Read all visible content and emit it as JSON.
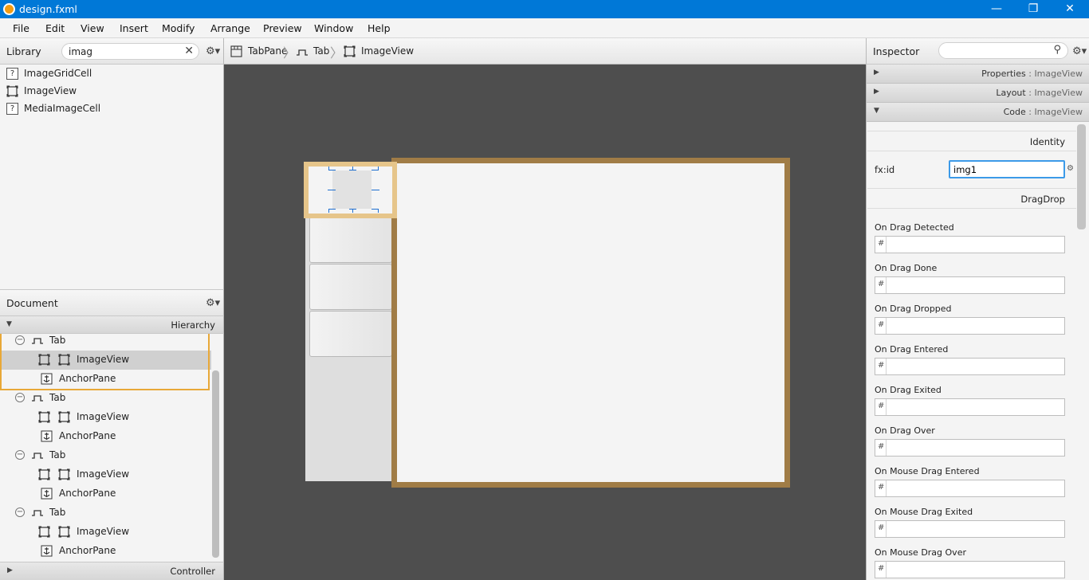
{
  "window": {
    "title": "design.fxml",
    "minimize_glyph": "—",
    "maximize_glyph": "❐",
    "close_glyph": "✕"
  },
  "menu": [
    "File",
    "Edit",
    "View",
    "Insert",
    "Modify",
    "Arrange",
    "Preview",
    "Window",
    "Help"
  ],
  "library": {
    "title": "Library",
    "search_value": "imag",
    "clear_glyph": "✕",
    "gear_glyph": "⚙▾",
    "items": [
      {
        "label": "ImageGridCell",
        "icon": "unknown-icon",
        "glyph": "?"
      },
      {
        "label": "ImageView",
        "icon": "imageview-icon",
        "glyph": ""
      },
      {
        "label": "MediaImageCell",
        "icon": "unknown-icon",
        "glyph": "?"
      }
    ]
  },
  "document": {
    "title": "Document",
    "gear_glyph": "⚙▾",
    "hierarchy_label": "Hierarchy",
    "hierarchy_arrow": "▼",
    "collapse_glyph": "−",
    "rows": [
      {
        "label": "Tab",
        "type": "tab"
      },
      {
        "label": "ImageView",
        "type": "imageview"
      },
      {
        "label": "AnchorPane",
        "type": "anchorpane"
      },
      {
        "label": "Tab",
        "type": "tab"
      },
      {
        "label": "ImageView",
        "type": "imageview"
      },
      {
        "label": "AnchorPane",
        "type": "anchorpane"
      },
      {
        "label": "Tab",
        "type": "tab"
      },
      {
        "label": "ImageView",
        "type": "imageview"
      },
      {
        "label": "AnchorPane",
        "type": "anchorpane"
      },
      {
        "label": "Tab",
        "type": "tab"
      },
      {
        "label": "ImageView",
        "type": "imageview"
      },
      {
        "label": "AnchorPane",
        "type": "anchorpane"
      }
    ],
    "controller_label": "Controller",
    "controller_arrow": "▶"
  },
  "breadcrumb": [
    {
      "label": "TabPane",
      "icon": "tabpane-icon"
    },
    {
      "label": "Tab",
      "icon": "tab-icon"
    },
    {
      "label": "ImageView",
      "icon": "imageview-icon"
    }
  ],
  "breadcrumb_sep": "〉",
  "inspector": {
    "title": "Inspector",
    "search_value": "",
    "search_glyph": "⚲",
    "gear_glyph": "⚙▾",
    "sections": [
      {
        "label": "Properties",
        "target": "ImageView",
        "arrow": "▶"
      },
      {
        "label": "Layout",
        "target": "ImageView",
        "arrow": "▶"
      },
      {
        "label": "Code",
        "target": "ImageView",
        "arrow": "▼"
      }
    ],
    "section_sep": " : ",
    "identity_label": "Identity",
    "fxid_label": "fx:id",
    "fxid_value": "img1",
    "fxid_gear": "⚙",
    "dragdrop_label": "DragDrop",
    "hash_glyph": "#",
    "events": [
      {
        "label": "On Drag Detected",
        "value": ""
      },
      {
        "label": "On Drag Done",
        "value": ""
      },
      {
        "label": "On Drag Dropped",
        "value": ""
      },
      {
        "label": "On Drag Entered",
        "value": ""
      },
      {
        "label": "On Drag Exited",
        "value": ""
      },
      {
        "label": "On Drag Over",
        "value": ""
      },
      {
        "label": "On Mouse Drag Entered",
        "value": ""
      },
      {
        "label": "On Mouse Drag Exited",
        "value": ""
      },
      {
        "label": "On Mouse Drag Over",
        "value": ""
      }
    ]
  },
  "colors": {
    "titlebar": "#0078d7",
    "canvas": "#4e4e4e",
    "selection_outline": "#e8a838",
    "content_frame": "#a07c46",
    "handles": "#1f6fd0",
    "focus_border": "#3c9ae8"
  }
}
